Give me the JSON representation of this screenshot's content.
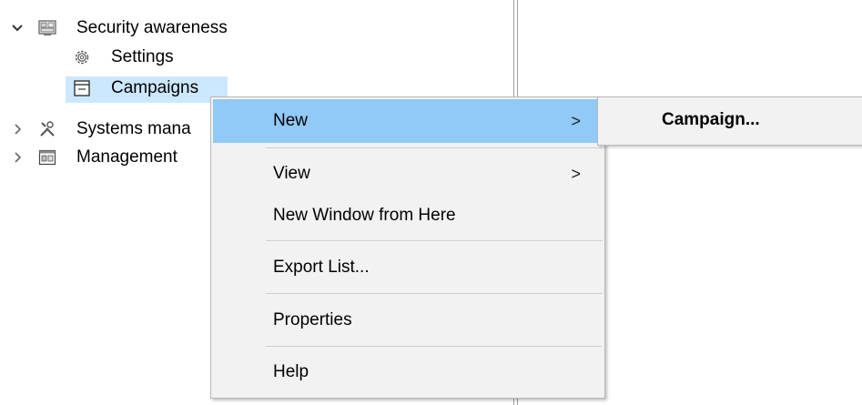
{
  "tree": {
    "items": [
      {
        "label": "Security awareness",
        "icon": "security-console-icon",
        "expanded": true
      },
      {
        "label": "Settings",
        "icon": "gear-icon"
      },
      {
        "label": "Campaigns",
        "icon": "window-icon",
        "selected": true
      },
      {
        "label": "Systems mana",
        "icon": "tools-icon",
        "expanded": false
      },
      {
        "label": "Management",
        "icon": "management-icon",
        "expanded": false
      }
    ]
  },
  "context_menu": {
    "items": [
      {
        "label": "New",
        "has_submenu": true,
        "highlighted": true
      },
      {
        "label": "View",
        "has_submenu": true
      },
      {
        "label": "New Window from Here"
      },
      {
        "label": "Export List..."
      },
      {
        "label": "Properties"
      },
      {
        "label": "Help"
      }
    ],
    "submenu_arrow": ">"
  },
  "submenu": {
    "items": [
      {
        "label": "Campaign..."
      }
    ]
  },
  "colors": {
    "selection": "#cce8ff",
    "menu_highlight": "#91c9f7",
    "menu_background": "#f2f2f2"
  }
}
